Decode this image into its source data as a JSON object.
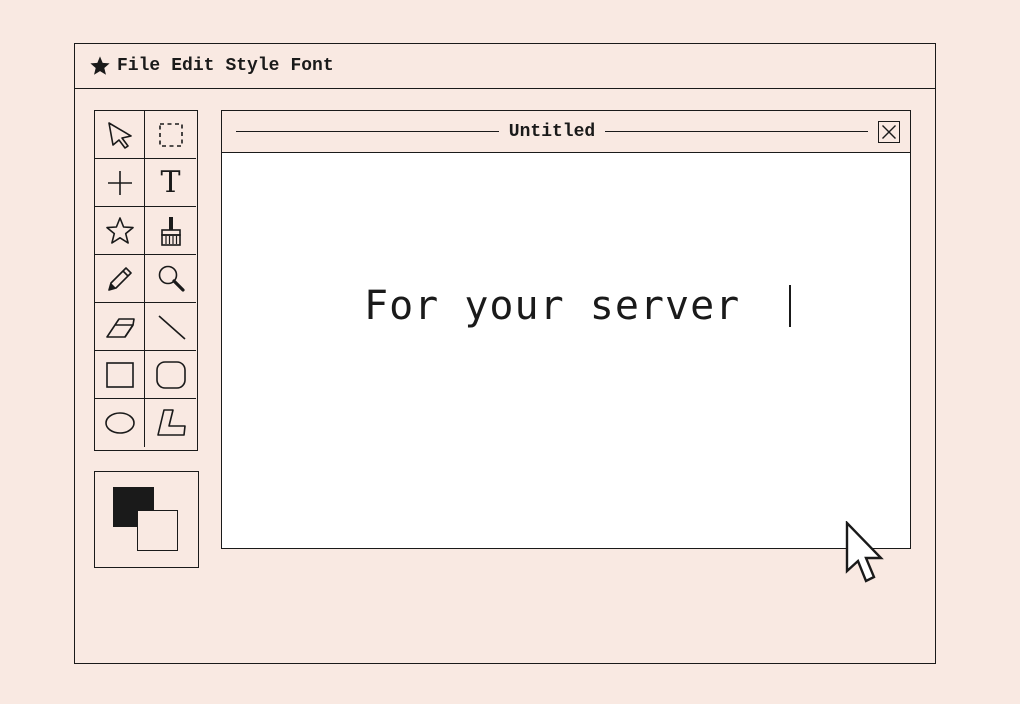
{
  "menubar": {
    "logo_icon": "star-icon",
    "items": [
      "File",
      "Edit",
      "Style",
      "Font"
    ]
  },
  "toolbox": {
    "tools": [
      {
        "name": "select-arrow",
        "icon": "arrow-pointer-icon"
      },
      {
        "name": "marquee-select",
        "icon": "dashed-rectangle-icon"
      },
      {
        "name": "crosshair",
        "icon": "plus-icon"
      },
      {
        "name": "text",
        "icon": "text-t-icon"
      },
      {
        "name": "star-shape",
        "icon": "star-outline-icon"
      },
      {
        "name": "paint-brush",
        "icon": "brush-icon"
      },
      {
        "name": "pencil",
        "icon": "pencil-icon"
      },
      {
        "name": "zoom",
        "icon": "magnifier-icon"
      },
      {
        "name": "eraser",
        "icon": "eraser-icon"
      },
      {
        "name": "line",
        "icon": "line-icon"
      },
      {
        "name": "rectangle",
        "icon": "rectangle-icon"
      },
      {
        "name": "rounded-rectangle",
        "icon": "rounded-rectangle-icon"
      },
      {
        "name": "ellipse",
        "icon": "ellipse-icon"
      },
      {
        "name": "polygon",
        "icon": "polygon-icon"
      }
    ],
    "text_tool_glyph": "T"
  },
  "colors": {
    "foreground": "#1a1a1a",
    "background": "#f9e9e2",
    "canvas": "#ffffff"
  },
  "document": {
    "title": "Untitled",
    "text": "For your server"
  }
}
